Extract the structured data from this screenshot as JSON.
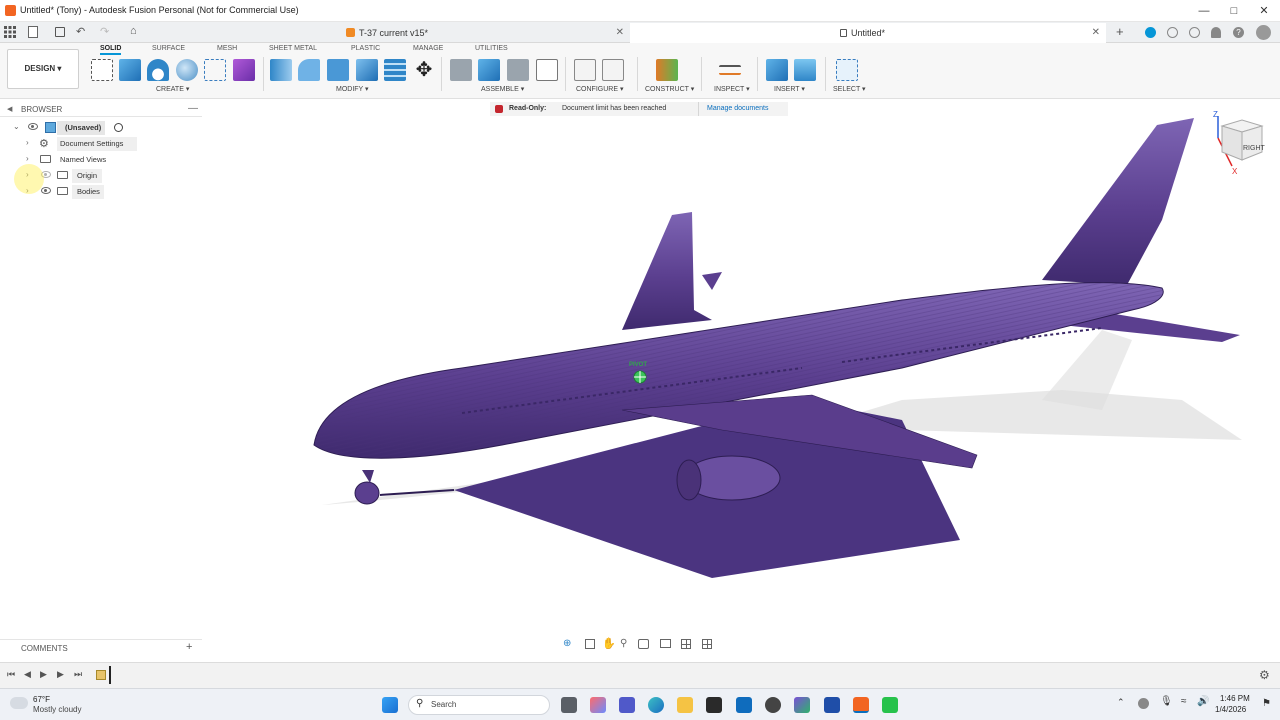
{
  "window": {
    "title": "Untitled* (Tony) - Autodesk Fusion Personal (Not for Commercial Use)"
  },
  "tabs": [
    {
      "label": "T-37 current v15*"
    },
    {
      "label": "Untitled*"
    }
  ],
  "workspace": {
    "label": "DESIGN"
  },
  "ribbon_tabs": [
    "SOLID",
    "SURFACE",
    "MESH",
    "SHEET METAL",
    "PLASTIC",
    "MANAGE",
    "UTILITIES"
  ],
  "groups": {
    "create": "CREATE",
    "modify": "MODIFY",
    "assemble": "ASSEMBLE",
    "configure": "CONFIGURE",
    "construct": "CONSTRUCT",
    "inspect": "INSPECT",
    "insert": "INSERT",
    "select": "SELECT"
  },
  "browser": {
    "title": "BROWSER",
    "root": "(Unsaved)",
    "items": [
      {
        "label": "Document Settings"
      },
      {
        "label": "Named Views"
      },
      {
        "label": "Origin"
      },
      {
        "label": "Bodies"
      }
    ]
  },
  "banner": {
    "label": "Read-Only:",
    "message": "Document limit has been reached",
    "link": "Manage documents"
  },
  "viewcube": {
    "face": "RIGHT",
    "axis_z": "Z",
    "axis_x": "X"
  },
  "model": {
    "pivot_label": "PIVOT"
  },
  "comments": {
    "title": "COMMENTS",
    "add": "+"
  },
  "taskbar": {
    "weather_temp": "67°F",
    "weather_desc": "Mostly cloudy",
    "search_placeholder": "Search",
    "time": "1:46 PM",
    "date": "1/4/2026"
  },
  "colors": {
    "model": "#5b3f8f",
    "accent": "#0696d7",
    "shadow": "#d9d9d9"
  }
}
